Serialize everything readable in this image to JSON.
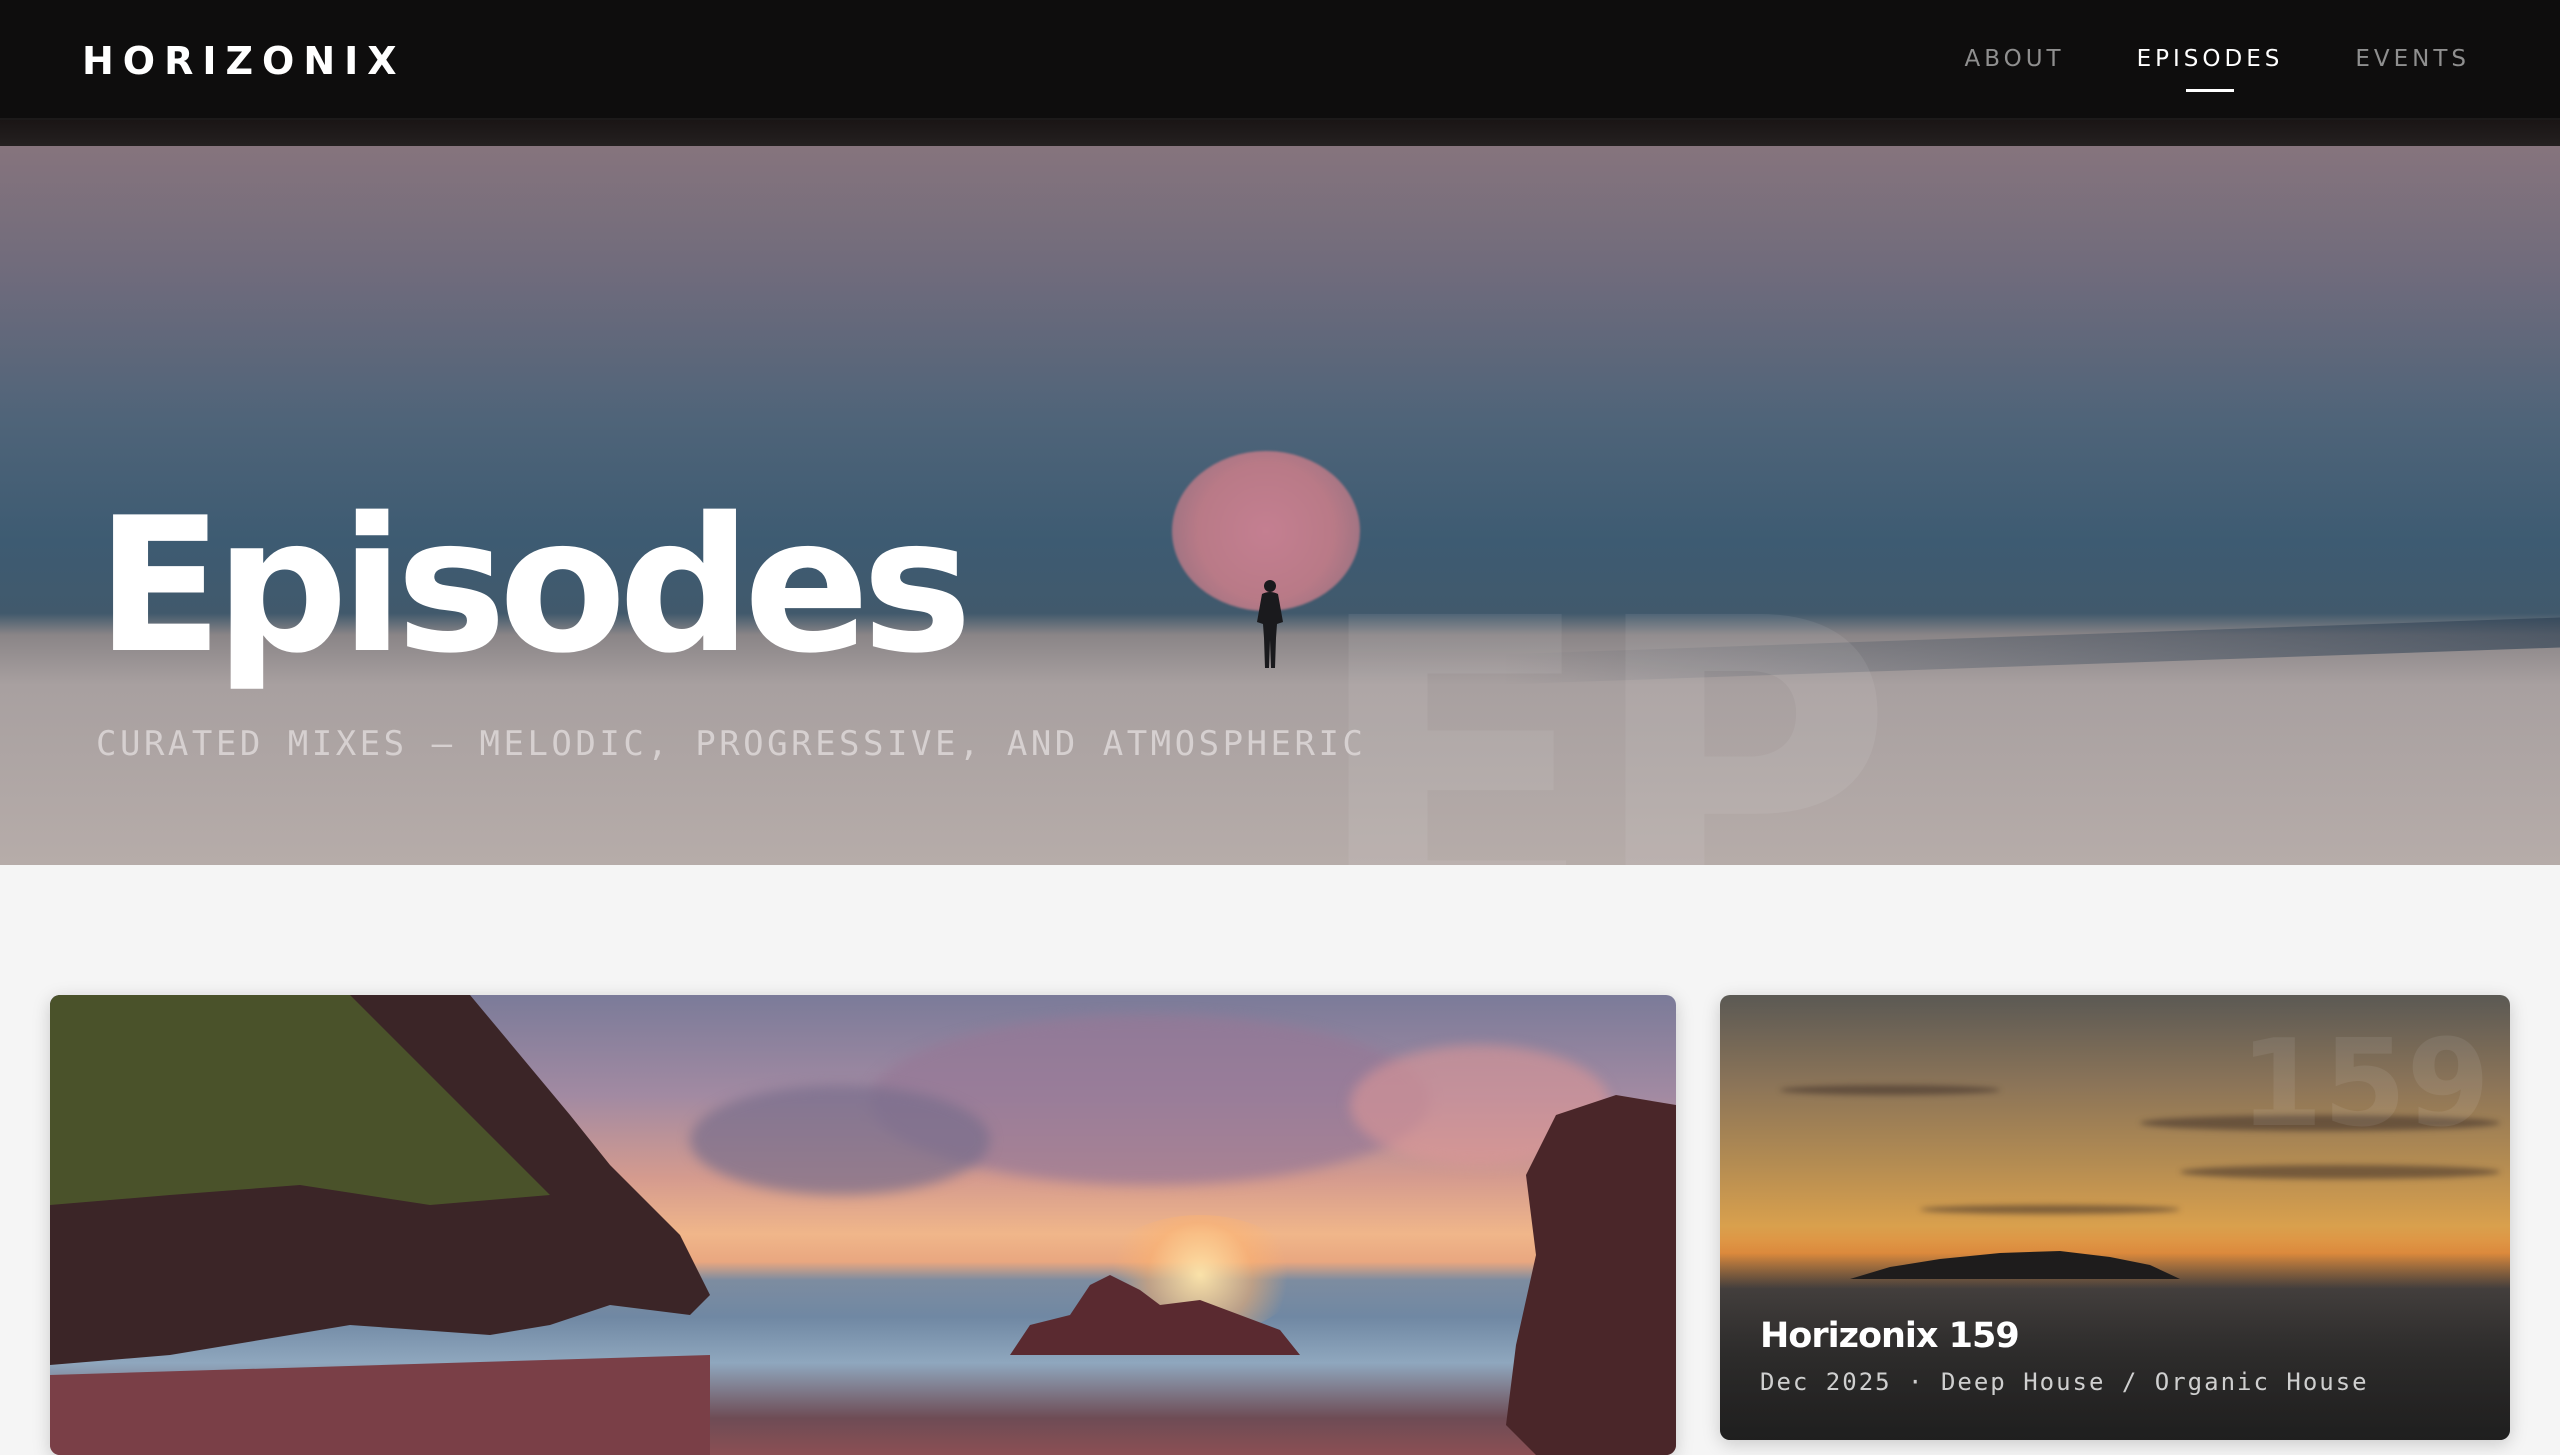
{
  "nav": {
    "logo": "HORIZONIX",
    "links": [
      {
        "label": "ABOUT",
        "active": false
      },
      {
        "label": "EPISODES",
        "active": true
      },
      {
        "label": "EVENTS",
        "active": false
      }
    ]
  },
  "hero": {
    "title": "Episodes",
    "subtitle": "CURATED MIXES — MELODIC, PROGRESSIVE, AND ATMOSPHERIC",
    "watermark": "EP"
  },
  "cards": [
    {
      "id": "featured",
      "image": "coastal-sunset-cliffs"
    },
    {
      "id": "episode-159",
      "title": "Horizonix 159",
      "meta": "Dec 2025 · Deep House / Organic House",
      "watermark": "159",
      "image": "sunset-over-island"
    }
  ]
}
